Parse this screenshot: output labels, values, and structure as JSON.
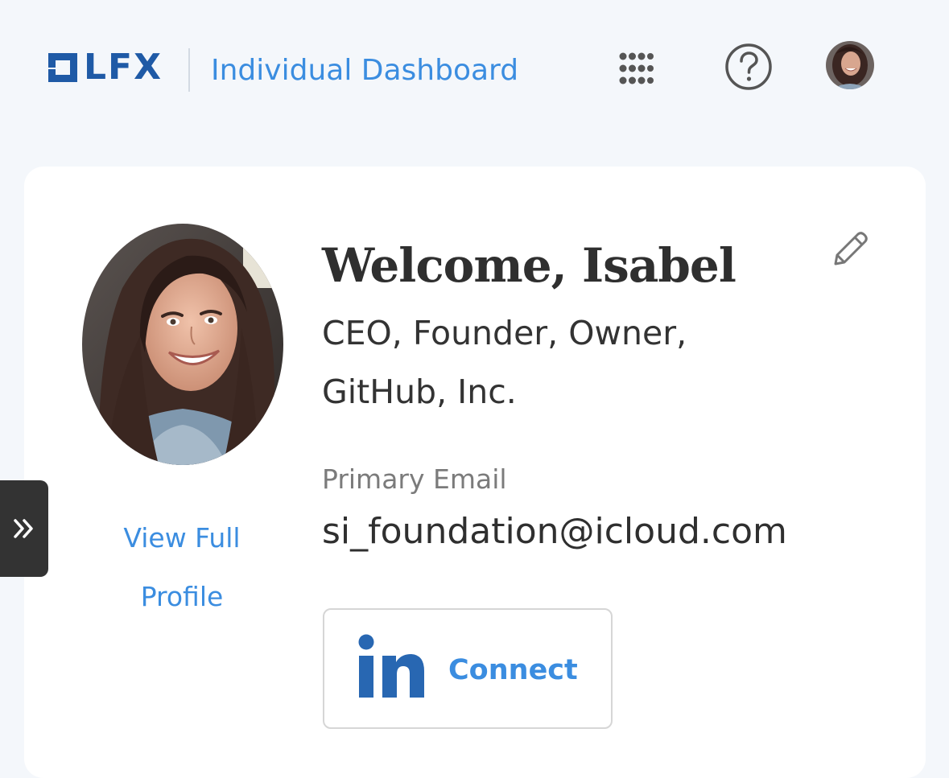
{
  "header": {
    "logo_text": "LFX",
    "app_title": "Individual Dashboard",
    "icons": {
      "apps": "apps-grid-icon",
      "help": "help-icon",
      "avatar": "user-avatar"
    }
  },
  "profile": {
    "welcome": "Welcome, Isabel",
    "job_title": "CEO, Founder, Owner, GitHub, Inc.",
    "email_label": "Primary Email",
    "email": "si_foundation@icloud.com",
    "view_profile_link": "View Full Profile",
    "linkedin_button": {
      "logo_text": "in",
      "label": "Connect"
    }
  },
  "sidebar": {
    "toggle_icon": "double-chevron-right-icon"
  },
  "colors": {
    "header_bg": "#f4f7fb",
    "accent": "#3b8de0",
    "logo": "#1f5aa6",
    "linkedin": "#2867b2",
    "text": "#2f2f2f",
    "muted": "#7b7b7b",
    "drawer": "#333333"
  }
}
